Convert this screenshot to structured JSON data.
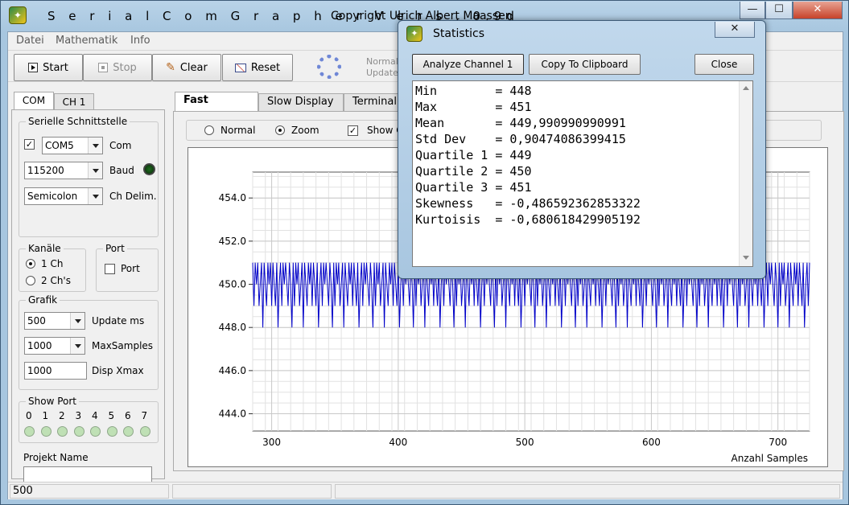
{
  "window": {
    "title": "S e r i a l C o m G r a p h e r   V e r s . 0.9d",
    "copyright": "Copyright Ulrich Albert Maassen",
    "icon": "app-icon"
  },
  "caption_buttons": {
    "minimize": "—",
    "maximize": "☐",
    "close": "✕"
  },
  "menu": [
    "Datei",
    "Mathematik",
    "Info"
  ],
  "toolbar": {
    "start": "Start",
    "stop": "Stop",
    "clear": "Clear",
    "reset": "Reset",
    "normal_label": "Normal:",
    "update_label": "Update"
  },
  "left_tabs": [
    "COM",
    "CH 1"
  ],
  "serial": {
    "legend": "Serielle Schnittstelle",
    "com_value": "COM5",
    "com_label": "Com",
    "baud_value": "115200",
    "baud_label": "Baud",
    "delim_value": "Semicolon",
    "delim_label": "Ch Delim."
  },
  "channels": {
    "legend": "Kanäle",
    "opt1": "1 Ch",
    "opt2": "2 Ch's"
  },
  "port": {
    "legend": "Port",
    "label": "Port"
  },
  "grafik": {
    "legend": "Grafik",
    "update_value": "500",
    "update_label": "Update ms",
    "maxsamples_value": "1000",
    "maxsamples_label": "MaxSamples",
    "dispx_value": "1000",
    "dispx_label": "Disp Xmax"
  },
  "showport": {
    "legend": "Show Port",
    "pins": [
      "0",
      "1",
      "2",
      "3",
      "4",
      "5",
      "6",
      "7"
    ]
  },
  "project": {
    "label": "Projekt Name",
    "value": ""
  },
  "main_tabs": [
    "Fast Display",
    "Slow Display",
    "Terminal"
  ],
  "display_opts": {
    "normal": "Normal",
    "zoom": "Zoom",
    "show": "Show C"
  },
  "status": {
    "pane1": "500"
  },
  "dialog": {
    "title": "Statistics",
    "analyze": "Analyze Channel 1",
    "copy": "Copy To Clipboard",
    "close": "Close",
    "stats": [
      {
        "name": "Min        ",
        "value": "448"
      },
      {
        "name": "Max        ",
        "value": "451"
      },
      {
        "name": "Mean       ",
        "value": "449,990990990991"
      },
      {
        "name": "Std Dev    ",
        "value": "0,90474086399415"
      },
      {
        "name": "Quartile 1 ",
        "value": "449"
      },
      {
        "name": "Quartile 2 ",
        "value": "450"
      },
      {
        "name": "Quartile 3 ",
        "value": "451"
      },
      {
        "name": "Skewness   ",
        "value": "-0,486592362853322"
      },
      {
        "name": "Kurtoisis  ",
        "value": "-0,680618429905192"
      }
    ]
  },
  "chart_data": {
    "type": "line",
    "xlabel": "Anzahl Samples",
    "xlim": [
      285,
      725
    ],
    "ylim": [
      443.2,
      455.2
    ],
    "x_ticks": [
      300,
      400,
      500,
      600,
      700
    ],
    "y_ticks": [
      "444.0",
      "446.0",
      "448.0",
      "450.0",
      "452.0",
      "454.0"
    ],
    "series": [
      {
        "color": "#0000c8",
        "pattern": [
          451,
          449,
          451,
          450,
          451,
          449,
          450,
          451,
          448,
          451,
          450,
          449,
          451,
          450,
          451,
          449,
          451,
          450,
          449,
          451,
          448,
          450,
          451,
          449,
          451,
          450,
          451,
          450,
          449,
          451,
          450,
          448
        ],
        "x_start": 285,
        "x_end": 725
      }
    ]
  }
}
